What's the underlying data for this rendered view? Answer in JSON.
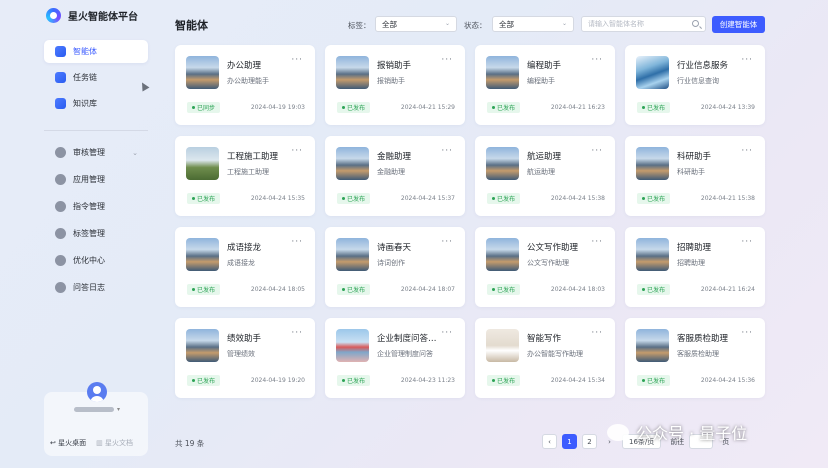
{
  "app": {
    "title": "星火智能体平台"
  },
  "sidebar": {
    "nav": [
      {
        "label": "智能体",
        "icon": "bot-icon",
        "active": true
      },
      {
        "label": "任务链",
        "icon": "chain-icon"
      },
      {
        "label": "知识库",
        "icon": "book-icon"
      }
    ],
    "admin": [
      {
        "label": "审核管理",
        "icon": "audit-icon",
        "expandable": true
      },
      {
        "label": "应用管理",
        "icon": "app-icon"
      },
      {
        "label": "指令管理",
        "icon": "command-icon"
      },
      {
        "label": "标签管理",
        "icon": "tag-icon"
      },
      {
        "label": "优化中心",
        "icon": "optimize-icon"
      },
      {
        "label": "问答日志",
        "icon": "log-icon"
      }
    ],
    "user": {
      "links": [
        "星火桌面",
        "星火文档"
      ]
    }
  },
  "header": {
    "title": "智能体",
    "tag_label": "标签：",
    "tag_value": "全部",
    "status_label": "状态：",
    "status_value": "全部",
    "search_placeholder": "请输入智能体名称",
    "create_label": "创建智能体"
  },
  "cards": [
    {
      "name": "办公助理",
      "desc": "办公助理能手",
      "status": "已同步",
      "time": "2024-04-19 19:03",
      "thumb": "mtn"
    },
    {
      "name": "报销助手",
      "desc": "报销助手",
      "status": "已发布",
      "time": "2024-04-21 15:29",
      "thumb": "mtn"
    },
    {
      "name": "编程助手",
      "desc": "编程助手",
      "status": "已发布",
      "time": "2024-04-21 16:23",
      "thumb": "mtn"
    },
    {
      "name": "行业信息服务",
      "desc": "行业信息查询",
      "status": "已发布",
      "time": "2024-04-24 13:39",
      "thumb": "wave"
    },
    {
      "name": "工程施工助理",
      "desc": "工程施工助理",
      "status": "已发布",
      "time": "2024-04-24 15:35",
      "thumb": "field"
    },
    {
      "name": "金融助理",
      "desc": "金融助理",
      "status": "已发布",
      "time": "2024-04-24 15:37",
      "thumb": "mtn"
    },
    {
      "name": "航运助理",
      "desc": "航运助理",
      "status": "已发布",
      "time": "2024-04-24 15:38",
      "thumb": "mtn"
    },
    {
      "name": "科研助手",
      "desc": "科研助手",
      "status": "已发布",
      "time": "2024-04-21 15:38",
      "thumb": "mtn"
    },
    {
      "name": "成语接龙",
      "desc": "成语接龙",
      "status": "已发布",
      "time": "2024-04-24 18:05",
      "thumb": "mtn"
    },
    {
      "name": "诗画春天",
      "desc": "诗词创作",
      "status": "已发布",
      "time": "2024-04-24 18:07",
      "thumb": "mtn"
    },
    {
      "name": "公文写作助理",
      "desc": "公文写作助理",
      "status": "已发布",
      "time": "2024-04-24 18:03",
      "thumb": "mtn"
    },
    {
      "name": "招聘助理",
      "desc": "招聘助理",
      "status": "已发布",
      "time": "2024-04-21 16:24",
      "thumb": "mtn"
    },
    {
      "name": "绩效助手",
      "desc": "管理绩效",
      "status": "已发布",
      "time": "2024-04-19 19:20",
      "thumb": "mtn"
    },
    {
      "name": "企业制度问答…",
      "desc": "企业管理制度问答",
      "status": "已发布",
      "time": "2024-04-23 11:23",
      "thumb": "city"
    },
    {
      "name": "智能写作",
      "desc": "办公智能写作助理",
      "status": "已发布",
      "time": "2024-04-24 15:34",
      "thumb": "room"
    },
    {
      "name": "客服质检助理",
      "desc": "客服质检助理",
      "status": "已发布",
      "time": "2024-04-24 15:36",
      "thumb": "mtn"
    }
  ],
  "footer": {
    "total": "共 19 条",
    "pages": [
      "1",
      "2"
    ],
    "current_page": "1",
    "page_size": "16条/页",
    "goto_label": "前往",
    "goto_suffix": "页"
  },
  "watermark": "公众号 · 量子位",
  "colors": {
    "accent": "#3d5cff",
    "status_green": "#2da456",
    "status_bg": "#e6f7ec"
  }
}
